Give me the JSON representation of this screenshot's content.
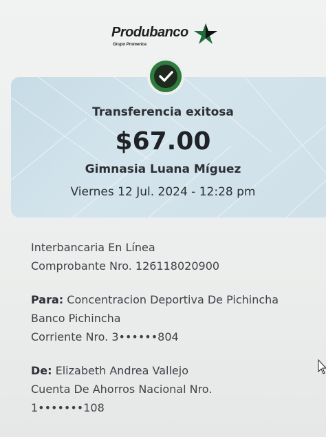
{
  "brand": {
    "name": "Produbanco",
    "subtitle": "Grupo Promerica"
  },
  "receipt": {
    "title": "Transferencia exitosa",
    "amount": "$67.00",
    "beneficiary": "Gimnasia Luana Míguez",
    "datetime": "Viernes 12 Jul. 2024 - 12:28 pm"
  },
  "details": {
    "type": "Interbancaria En Línea",
    "voucher": "Comprobante Nro. 126118020900",
    "to_label": "Para:",
    "to_name": "Concentracion Deportiva De Pichincha",
    "to_bank": "Banco Pichincha",
    "to_account": "Corriente Nro. 3••••••804",
    "from_label": "De:",
    "from_name": "Elizabeth Andrea Vallejo",
    "from_account_type": "Cuenta De Ahorros Nacional Nro.",
    "from_account_number": "1•••••••108"
  },
  "colors": {
    "success_green": "#2f7d3e",
    "card_bg": "#cfe0e8",
    "logo_star": "#1f6b3a"
  },
  "icons": {
    "success": "check-circle-icon",
    "brand": "star-logo-icon",
    "pointer": "mouse-cursor-icon"
  }
}
